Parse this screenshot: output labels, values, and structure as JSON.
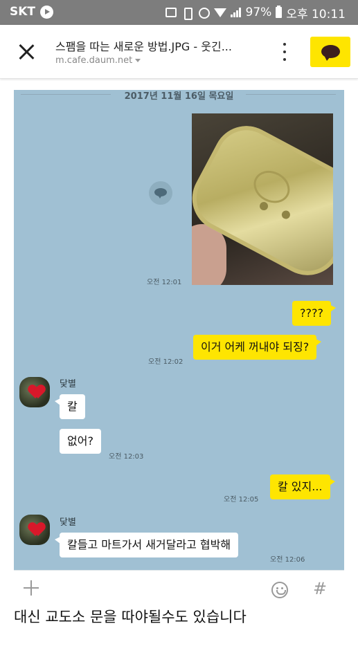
{
  "status_bar": {
    "carrier": "SKT",
    "battery": "97%",
    "time": "오후 10:11",
    "icons": [
      "play-icon",
      "hd-icon",
      "vibrate-icon",
      "alarm-icon",
      "wifi-icon",
      "signal-icon",
      "battery-icon"
    ]
  },
  "browser": {
    "page_title": "스팸을 따는 새로운 방법.JPG - 웃긴...",
    "url": "m.cafe.daum.net",
    "buttons": {
      "close": "close-icon",
      "more": "more-vertical-icon",
      "kakao_share": "kakao-talk-icon"
    },
    "colors": {
      "kakao_yellow": "#fee500",
      "kakao_brown": "#3b1e1e"
    }
  },
  "chat": {
    "date_separator": "2017년 11월 16일 목요일",
    "background": "#a0c0d3",
    "photo_message": {
      "time": "오전 12:01",
      "description_icon": "photo-message"
    },
    "messages": [
      {
        "from": "me",
        "text": "????",
        "time": ""
      },
      {
        "from": "me",
        "text": "이거 어케 꺼내야 되징?",
        "time": "오전 12:02"
      },
      {
        "from": "them",
        "sender": "닻별",
        "text": "칼",
        "time": ""
      },
      {
        "from": "them",
        "text": "없어?",
        "time": "오전 12:03"
      },
      {
        "from": "me",
        "text": "칼 있지...",
        "time": "오전 12:05"
      },
      {
        "from": "them",
        "sender": "닻별",
        "text": "칼들고 마트가서 새거달라고 협박해",
        "time": "오전 12:06"
      }
    ],
    "colors": {
      "my_bubble": "#fee501",
      "their_bubble": "#ffffff"
    }
  },
  "input_bar": {
    "icons": [
      "plus-icon",
      "emoji-icon",
      "hash-icon"
    ],
    "hash_glyph": "#"
  },
  "caption": "대신 교도소 문을 따야될수도 있습니다"
}
